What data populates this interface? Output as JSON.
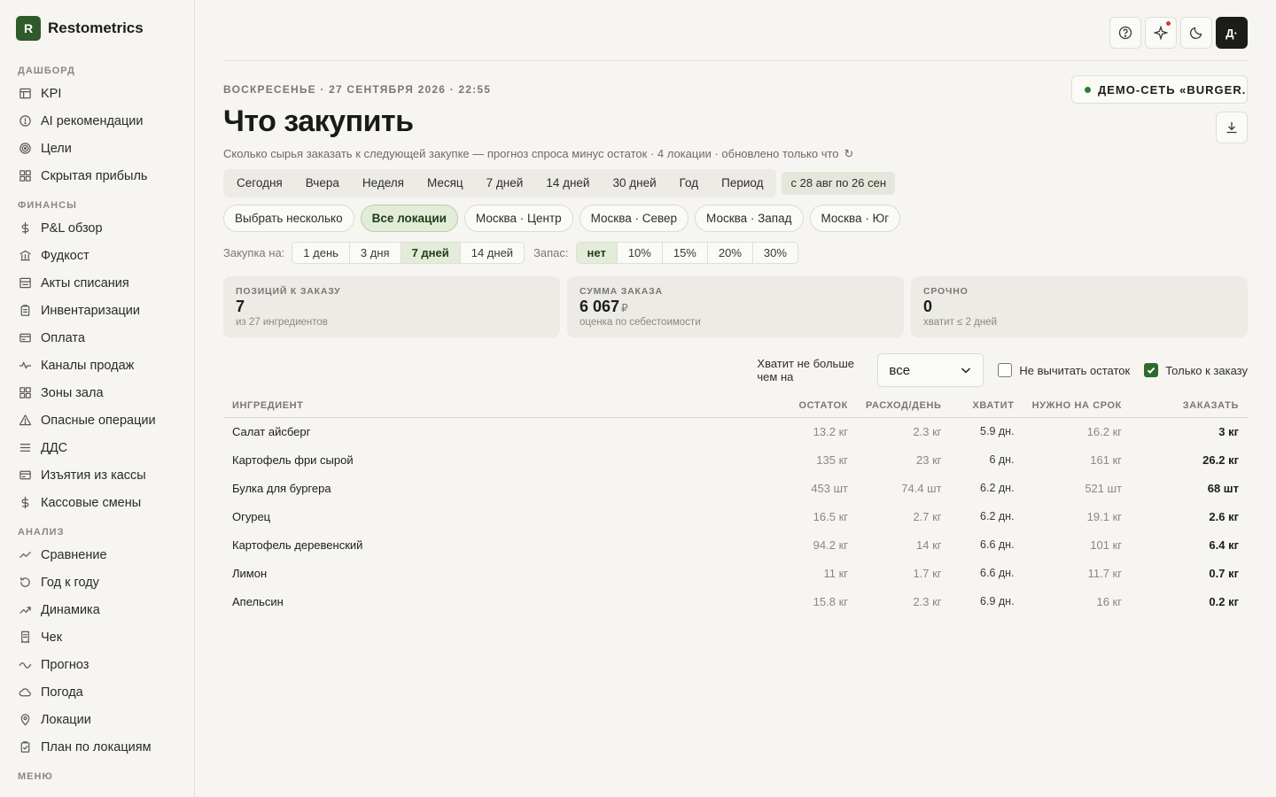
{
  "brand": {
    "logo_letter": "R",
    "name": "Restometrics"
  },
  "sidebar": {
    "sections": [
      {
        "title": "ДАШБОРД",
        "items": [
          {
            "label": "KPI",
            "icon": "table-icon"
          },
          {
            "label": "AI рекомендации",
            "icon": "alert-circle-icon"
          },
          {
            "label": "Цели",
            "icon": "target-icon"
          },
          {
            "label": "Скрытая прибыль",
            "icon": "grid-icon"
          }
        ]
      },
      {
        "title": "ФИНАНСЫ",
        "items": [
          {
            "label": "P&L обзор",
            "icon": "dollar-icon"
          },
          {
            "label": "Фудкост",
            "icon": "bank-icon"
          },
          {
            "label": "Акты списания",
            "icon": "ledger-icon"
          },
          {
            "label": "Инвентаризации",
            "icon": "clipboard-icon"
          },
          {
            "label": "Оплата",
            "icon": "card-icon"
          },
          {
            "label": "Каналы продаж",
            "icon": "pulse-icon"
          },
          {
            "label": "Зоны зала",
            "icon": "grid-icon"
          },
          {
            "label": "Опасные операции",
            "icon": "warning-icon"
          },
          {
            "label": "ДДС",
            "icon": "list-icon"
          },
          {
            "label": "Изъятия из кассы",
            "icon": "card-icon"
          },
          {
            "label": "Кассовые смены",
            "icon": "dollar-icon"
          }
        ]
      },
      {
        "title": "АНАЛИЗ",
        "items": [
          {
            "label": "Сравнение",
            "icon": "compare-icon"
          },
          {
            "label": "Год к году",
            "icon": "history-icon"
          },
          {
            "label": "Динамика",
            "icon": "trend-icon"
          },
          {
            "label": "Чек",
            "icon": "receipt-icon"
          },
          {
            "label": "Прогноз",
            "icon": "wave-icon"
          },
          {
            "label": "Погода",
            "icon": "cloud-icon"
          },
          {
            "label": "Локации",
            "icon": "pin-icon"
          },
          {
            "label": "План по локациям",
            "icon": "clipboard-check-icon"
          }
        ]
      },
      {
        "title": "МЕНЮ",
        "items": []
      }
    ]
  },
  "topbar": {
    "avatar_label": "Д·"
  },
  "header": {
    "dateline": "ВОСКРЕСЕНЬЕ · 27 СЕНТЯБРЯ 2026 · 22:55",
    "org": "ДЕМО-СЕТЬ «BURGER...",
    "title": "Что закупить",
    "subtitle": "Сколько сырья заказать к следующей закупке — прогноз спроса минус остаток · 4 локации · обновлено только что",
    "refresh_glyph": "↻"
  },
  "periods": [
    "Сегодня",
    "Вчера",
    "Неделя",
    "Месяц",
    "7 дней",
    "14 дней",
    "30 дней",
    "Год",
    "Период"
  ],
  "range": "с 28 авг по 26 сен",
  "locations": [
    {
      "label": "Выбрать несколько",
      "active": false
    },
    {
      "label": "Все локации",
      "active": true
    },
    {
      "label": "Москва · Центр",
      "active": false
    },
    {
      "label": "Москва · Север",
      "active": false
    },
    {
      "label": "Москва · Запад",
      "active": false
    },
    {
      "label": "Москва · Юг",
      "active": false
    }
  ],
  "purchase": {
    "label": "Закупка на:",
    "options": [
      "1 день",
      "3 дня",
      "7 дней",
      "14 дней"
    ],
    "active": 2
  },
  "reserve": {
    "label": "Запас:",
    "options": [
      "нет",
      "10%",
      "15%",
      "20%",
      "30%"
    ],
    "active": 0
  },
  "kpis": [
    {
      "label": "ПОЗИЦИЙ К ЗАКАЗУ",
      "value": "7",
      "currency": "",
      "sub": "из 27 ингредиентов"
    },
    {
      "label": "СУММА ЗАКАЗА",
      "value": "6 067",
      "currency": "₽",
      "sub": "оценка по себестоимости"
    },
    {
      "label": "СРОЧНО",
      "value": "0",
      "currency": "",
      "sub": "хватит ≤ 2 дней"
    }
  ],
  "filters": {
    "enough_label": "Хватит не больше чем на",
    "enough_value": "все",
    "no_subtract_label": "Не вычитать остаток",
    "no_subtract_checked": false,
    "only_order_label": "Только к заказу",
    "only_order_checked": true
  },
  "table": {
    "columns": [
      "ИНГРЕДИЕНТ",
      "ОСТАТОК",
      "РАСХОД/ДЕНЬ",
      "ХВАТИТ",
      "НУЖНО НА СРОК",
      "ЗАКАЗАТЬ"
    ],
    "rows": [
      [
        "Салат айсберг",
        "13.2 кг",
        "2.3 кг",
        "5.9 дн.",
        "16.2 кг",
        "3 кг"
      ],
      [
        "Картофель фри сырой",
        "135 кг",
        "23 кг",
        "6 дн.",
        "161 кг",
        "26.2 кг"
      ],
      [
        "Булка для бургера",
        "453 шт",
        "74.4 шт",
        "6.2 дн.",
        "521 шт",
        "68 шт"
      ],
      [
        "Огурец",
        "16.5 кг",
        "2.7 кг",
        "6.2 дн.",
        "19.1 кг",
        "2.6 кг"
      ],
      [
        "Картофель деревенский",
        "94.2 кг",
        "14 кг",
        "6.6 дн.",
        "101 кг",
        "6.4 кг"
      ],
      [
        "Лимон",
        "11 кг",
        "1.7 кг",
        "6.6 дн.",
        "11.7 кг",
        "0.7 кг"
      ],
      [
        "Апельсин",
        "15.8 кг",
        "2.3 кг",
        "6.9 дн.",
        "16 кг",
        "0.2 кг"
      ]
    ]
  }
}
